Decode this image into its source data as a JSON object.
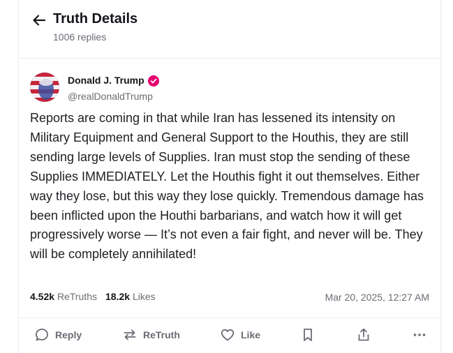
{
  "header": {
    "title": "Truth Details",
    "replies": "1006 replies"
  },
  "post": {
    "author_name": "Donald J. Trump",
    "handle": "@realDonaldTrump",
    "text": "Reports are coming in that while Iran has lessened its intensity on Military Equipment and General Support to the Houthis, they are still sending large levels of Supplies. Iran must stop the sending of these Supplies IMMEDIATELY. Let the Houthis fight it out themselves. Either way they lose, but this way they lose quickly. Tremendous damage has been inflicted upon the Houthi barbarians, and watch how it will get progressively worse — It’s not even a fair fight, and never will be. They will be completely annihilated!",
    "retruths_count": "4.52k",
    "retruths_label": "ReTruths",
    "likes_count": "18.2k",
    "likes_label": "Likes",
    "timestamp": "Mar 20, 2025, 12:27 AM"
  },
  "actions": {
    "reply": "Reply",
    "retruth": "ReTruth",
    "like": "Like"
  },
  "colors": {
    "verified_badge": "#e4006e",
    "muted_text": "#6b6b74",
    "divider": "#ececf0"
  }
}
